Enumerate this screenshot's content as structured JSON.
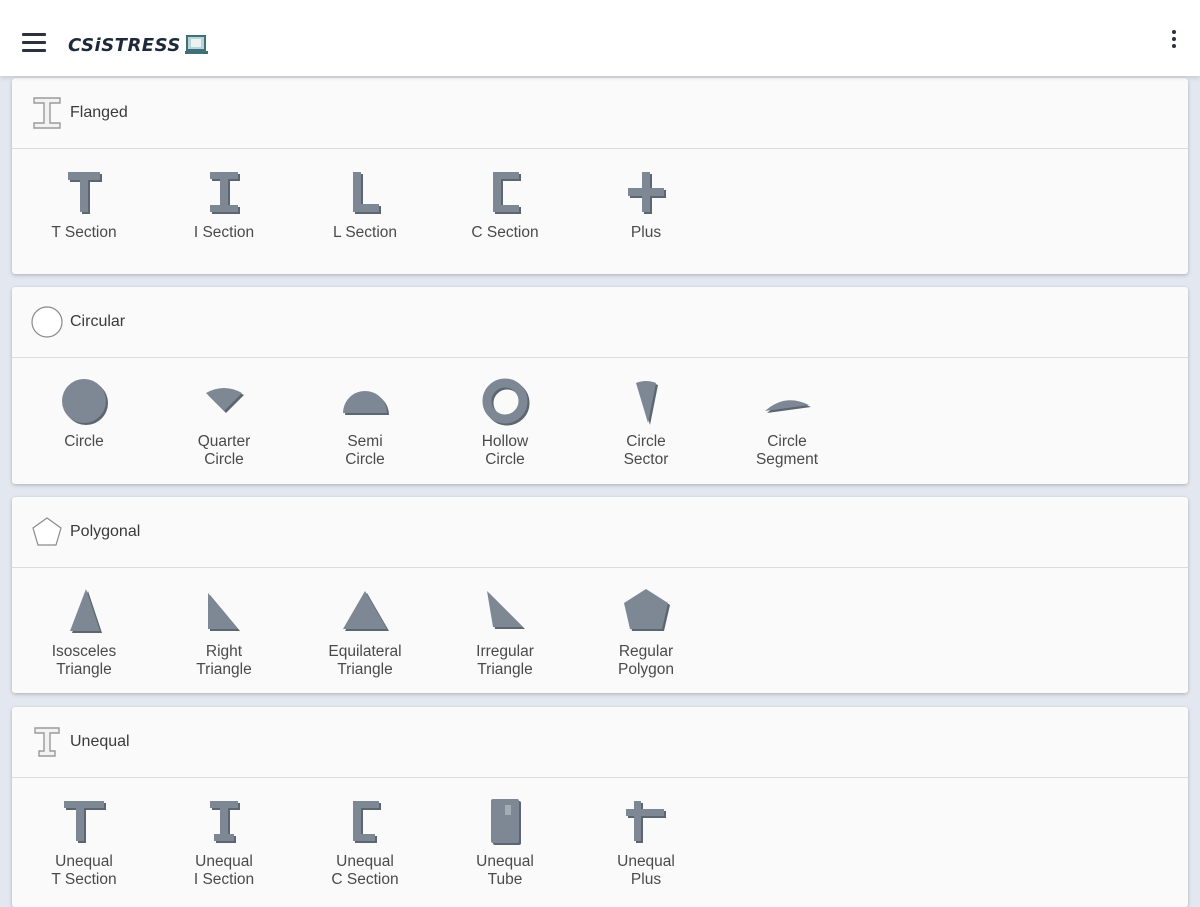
{
  "app": {
    "logo_text": "CSiSTRESS"
  },
  "sections": [
    {
      "title": "Flanged",
      "icon": "i-beam-outline-icon",
      "items": [
        {
          "label": "T Section",
          "icon": "t-section-icon"
        },
        {
          "label": "I Section",
          "icon": "i-section-icon"
        },
        {
          "label": "L Section",
          "icon": "l-section-icon"
        },
        {
          "label": "C Section",
          "icon": "c-section-icon"
        },
        {
          "label": "Plus",
          "icon": "plus-section-icon"
        }
      ]
    },
    {
      "title": "Circular",
      "icon": "circle-outline-icon",
      "items": [
        {
          "label": "Circle",
          "icon": "circle-icon"
        },
        {
          "label": "Quarter\nCircle",
          "icon": "quarter-circle-icon"
        },
        {
          "label": "Semi\nCircle",
          "icon": "semi-circle-icon"
        },
        {
          "label": "Hollow\nCircle",
          "icon": "hollow-circle-icon"
        },
        {
          "label": "Circle\nSector",
          "icon": "circle-sector-icon"
        },
        {
          "label": "Circle\nSegment",
          "icon": "circle-segment-icon"
        }
      ]
    },
    {
      "title": "Polygonal",
      "icon": "pentagon-outline-icon",
      "items": [
        {
          "label": "Isosceles\nTriangle",
          "icon": "isosceles-triangle-icon"
        },
        {
          "label": "Right\nTriangle",
          "icon": "right-triangle-icon"
        },
        {
          "label": "Equilateral\nTriangle",
          "icon": "equilateral-triangle-icon"
        },
        {
          "label": "Irregular\nTriangle",
          "icon": "irregular-triangle-icon"
        },
        {
          "label": "Regular\nPolygon",
          "icon": "regular-polygon-icon"
        }
      ]
    },
    {
      "title": "Unequal",
      "icon": "unequal-i-beam-outline-icon",
      "items": [
        {
          "label": "Unequal\nT Section",
          "icon": "unequal-t-section-icon"
        },
        {
          "label": "Unequal\nI Section",
          "icon": "unequal-i-section-icon"
        },
        {
          "label": "Unequal\nC Section",
          "icon": "unequal-c-section-icon"
        },
        {
          "label": "Unequal\nTube",
          "icon": "unequal-tube-icon"
        },
        {
          "label": "Unequal\nPlus",
          "icon": "unequal-plus-icon"
        }
      ]
    }
  ],
  "colors": {
    "shape_fill": "#7d8894",
    "shape_dark": "#5c6670",
    "outline": "#8a8a8a"
  }
}
